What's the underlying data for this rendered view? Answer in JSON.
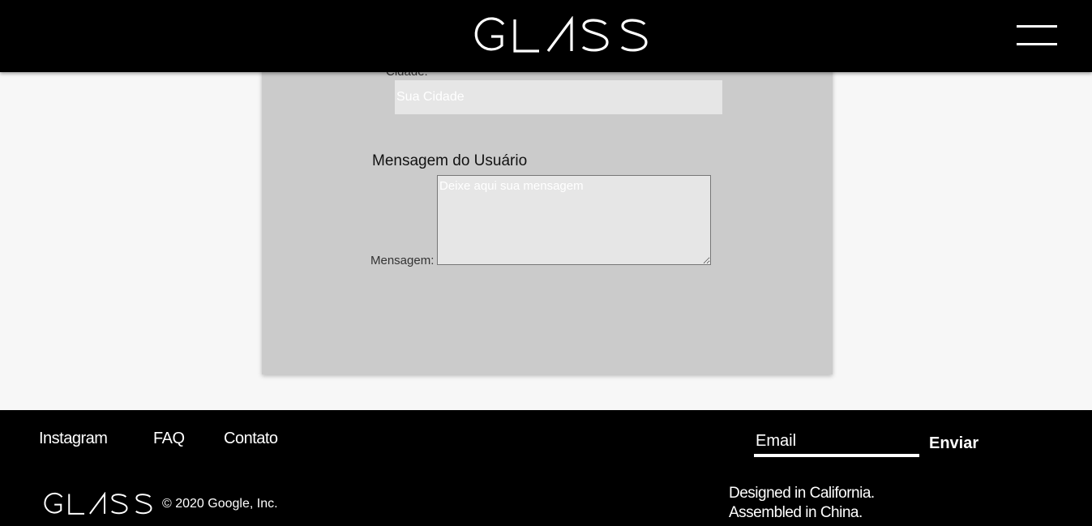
{
  "header": {
    "logo_text": "GLASS",
    "menu_icon": "hamburger-icon"
  },
  "form": {
    "cidade_label": "Cidade:",
    "cidade_placeholder": "Sua Cidade",
    "section_title": "Mensagem do Usuário",
    "message_label": "Mensagem:",
    "message_placeholder": "Deixe aqui sua mensagem"
  },
  "footer": {
    "links": [
      "Instagram",
      "FAQ",
      "Contato"
    ],
    "email_placeholder": "Email",
    "submit_label": "Enviar",
    "logo_text": "GLASS",
    "copyright": "© 2020 Google, Inc.",
    "tagline_line1": "Designed in California.",
    "tagline_line2": "Assembled in China."
  },
  "colors": {
    "header_bg": "#000000",
    "page_bg": "#f7f7f7",
    "card_bg": "#cbcbcb",
    "input_bg": "#e6e6e6",
    "footer_bg": "#000000"
  }
}
